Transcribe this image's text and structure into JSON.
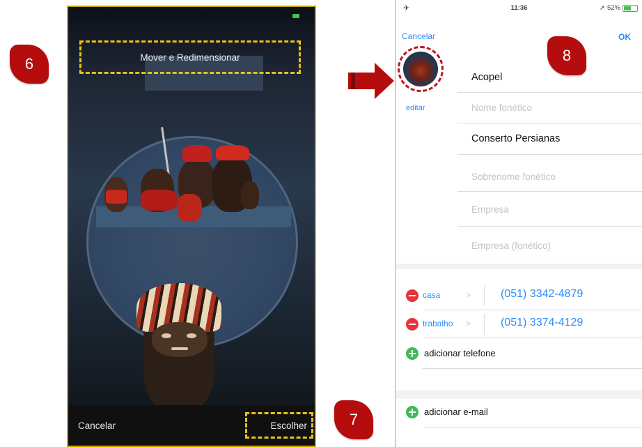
{
  "badges": {
    "step6": "6",
    "step7": "7",
    "step8": "8"
  },
  "left_screen": {
    "title": "Mover e Redimensionar",
    "cancel": "Cancelar",
    "choose": "Escolher"
  },
  "right_screen": {
    "status": {
      "time": "11:36",
      "battery": "52%"
    },
    "nav": {
      "cancel": "Cancelar",
      "ok": "OK"
    },
    "avatar": {
      "edit": "editar"
    },
    "fields": {
      "first_name": "Acopel",
      "phonetic_name_placeholder": "Nome fonético",
      "last_name": "Conserto Persianas",
      "phonetic_last_placeholder": "Sobrenome fonético",
      "company_placeholder": "Empresa",
      "phonetic_company_placeholder": "Empresa (fonético)"
    },
    "phones": [
      {
        "label": "casa",
        "number": "(051) 3342-4879"
      },
      {
        "label": "trabalho",
        "number": "(051) 3374-4129"
      }
    ],
    "add_phone": "adicionar telefone",
    "add_email": "adicionar e-mail"
  },
  "colors": {
    "accent_blue": "#2f8cf6",
    "highlight_yellow": "#e7c21d",
    "badge_red": "#b50d0d",
    "remove_red": "#e6353a",
    "add_green": "#3fbc55"
  }
}
